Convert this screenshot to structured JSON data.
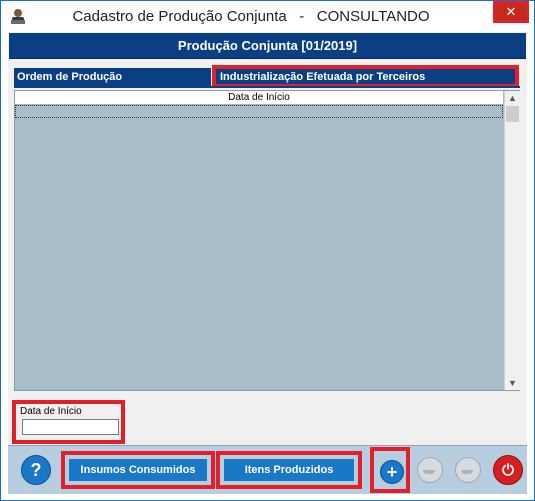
{
  "window": {
    "title": "Cadastro de Produção Conjunta   -   CONSULTANDO",
    "close_glyph": "✕"
  },
  "header": {
    "title": "Produção Conjunta [01/2019]"
  },
  "tabs": [
    {
      "label": "Ordem de Produção"
    },
    {
      "label": "Industrialização Efetuada por Terceiros"
    }
  ],
  "grid": {
    "columns": [
      "Data de Início"
    ],
    "scroll_up": "▲",
    "scroll_down": "▼"
  },
  "filter": {
    "label": "Data de Início",
    "value": ""
  },
  "footer": {
    "help_glyph": "?",
    "insumos_label": "Insumos Consumidos",
    "itens_label": "Itens Produzidos",
    "add_glyph": "+",
    "power_glyph": "⏻"
  },
  "colors": {
    "accent_blue": "#0b3f84",
    "button_blue": "#1a78c9",
    "highlight_red": "#e0202a",
    "grid_bg": "#a9bec8"
  }
}
